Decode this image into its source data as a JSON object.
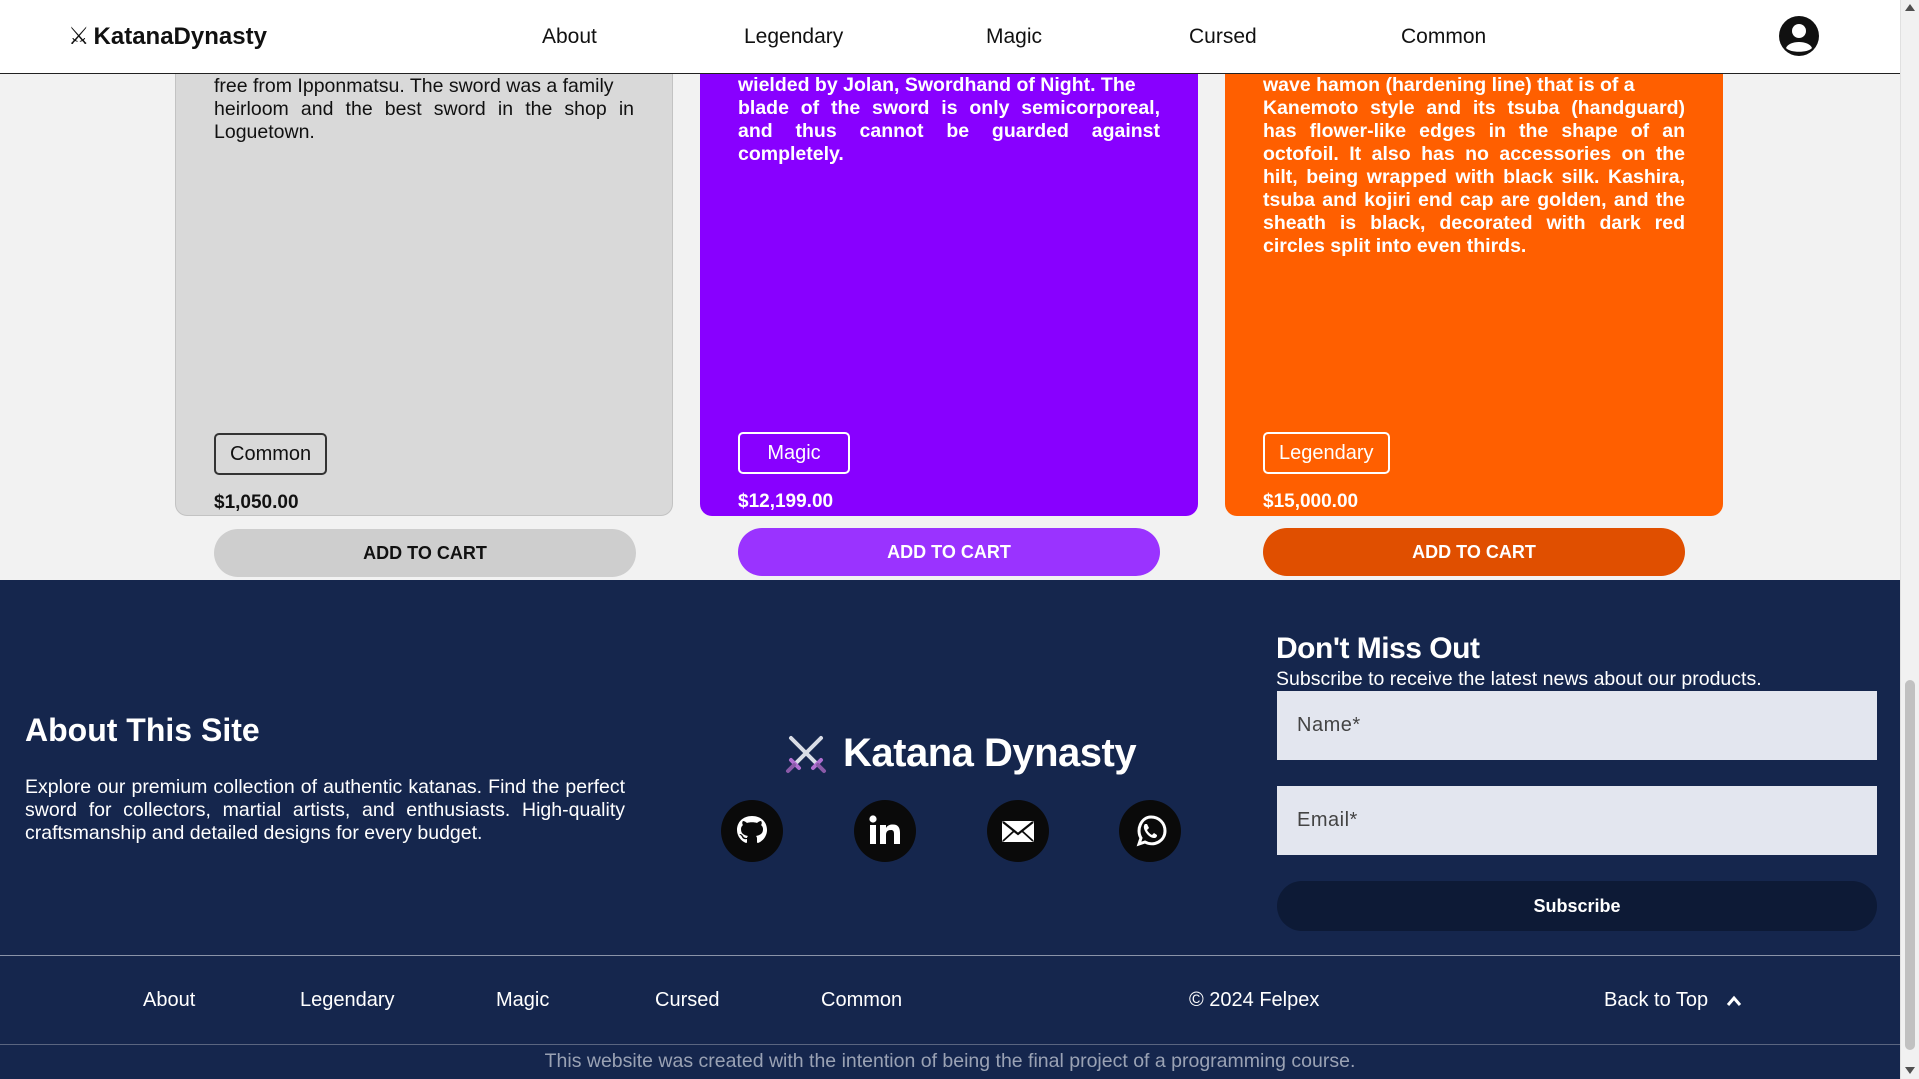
{
  "header": {
    "brand_icon": "⚔",
    "brand": "KatanaDynasty",
    "nav": [
      "About",
      "Legendary",
      "Magic",
      "Cursed",
      "Common"
    ]
  },
  "cards": [
    {
      "desc_clipped": "free from Ipponmatsu. The sword was a family",
      "desc": "heirloom and the best sword in the shop in Loguetown.",
      "badge": "Common",
      "price": "$1,050.00",
      "cart": "ADD TO CART"
    },
    {
      "desc_clipped": "wielded by Jolan, Swordhand of Night. The",
      "desc": "blade of the sword is only semicorporeal, and thus cannot be guarded against completely.",
      "badge": "Magic",
      "price": "$12,199.00",
      "cart": "ADD TO CART"
    },
    {
      "desc_clipped": "wave hamon (hardening line) that is of a",
      "desc": "Kanemoto style and its tsuba (handguard) has flower-like edges in the shape of an octofoil. It also has no accessories on the hilt, being wrapped with black silk. Kashira, tsuba and kojiri end cap are golden, and the sheath is black, decorated with dark red circles split into even thirds.",
      "badge": "Legendary",
      "price": "$15,000.00",
      "cart": "ADD TO CART"
    }
  ],
  "footer": {
    "about_title": "About This Site",
    "about_text": "Explore our premium collection of authentic katanas. Find the perfect sword for collectors, martial artists, and enthusiasts. High-quality craftsmanship and detailed designs for every budget.",
    "logo_text": "Katana Dynasty",
    "socials": [
      "github-icon",
      "linkedin-icon",
      "mail-icon",
      "whatsapp-icon"
    ],
    "newsletter_title": "Don't Miss Out",
    "newsletter_sub": "Subscribe to receive the latest news about our products.",
    "name_placeholder": "Name*",
    "email_placeholder": "Email*",
    "subscribe": "Subscribe",
    "bottom_nav": [
      "About",
      "Legendary",
      "Magic",
      "Cursed",
      "Common"
    ],
    "copyright": "© 2024 Felpex",
    "back_to_top": "Back to Top",
    "note": "This website was created with the intention of being the final project of a programming course."
  },
  "colors": {
    "footer_bg": "#15264d",
    "magic": "#8800ff",
    "legendary": "#ff5f00",
    "common": "#d9d9d9"
  }
}
